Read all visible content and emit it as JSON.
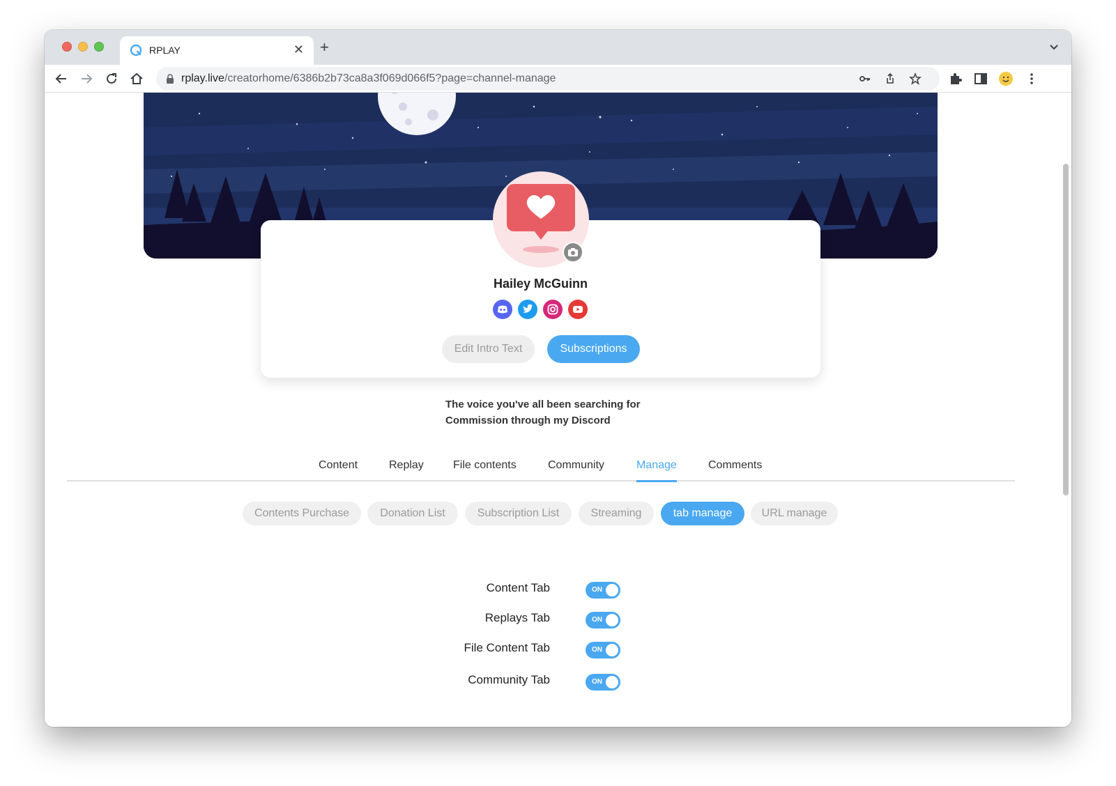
{
  "browser": {
    "tab_title": "RPLAY",
    "url_domain": "rplay.live",
    "url_path": "/creatorhome/6386b2b73ca8a3f069d066f5?page=channel-manage"
  },
  "profile": {
    "name": "Hailey McGuinn",
    "social_icons": [
      "discord-icon",
      "twitter-icon",
      "instagram-icon",
      "youtube-icon"
    ],
    "edit_intro_label": "Edit Intro Text",
    "subscriptions_label": "Subscriptions",
    "intro_line1": "The voice you've all been searching for",
    "intro_line2": "Commission through my Discord"
  },
  "main_tabs": [
    {
      "label": "Content",
      "active": false
    },
    {
      "label": "Replay",
      "active": false
    },
    {
      "label": "File contents",
      "active": false
    },
    {
      "label": "Community",
      "active": false
    },
    {
      "label": "Manage",
      "active": true
    },
    {
      "label": "Comments",
      "active": false
    }
  ],
  "sub_tabs": [
    {
      "label": "Contents Purchase",
      "active": false
    },
    {
      "label": "Donation List",
      "active": false
    },
    {
      "label": "Subscription List",
      "active": false
    },
    {
      "label": "Streaming",
      "active": false
    },
    {
      "label": "tab manage",
      "active": true
    },
    {
      "label": "URL manage",
      "active": false
    }
  ],
  "settings": [
    {
      "label": "Content Tab",
      "state": "ON"
    },
    {
      "label": "Replays Tab",
      "state": "ON"
    },
    {
      "label": "File Content Tab",
      "state": "ON"
    },
    {
      "label": "Community Tab",
      "state": "ON"
    }
  ],
  "colors": {
    "accent": "#4aa8f0",
    "banner_night": "#1b2b55",
    "avatar_heart": "#e85d63"
  }
}
